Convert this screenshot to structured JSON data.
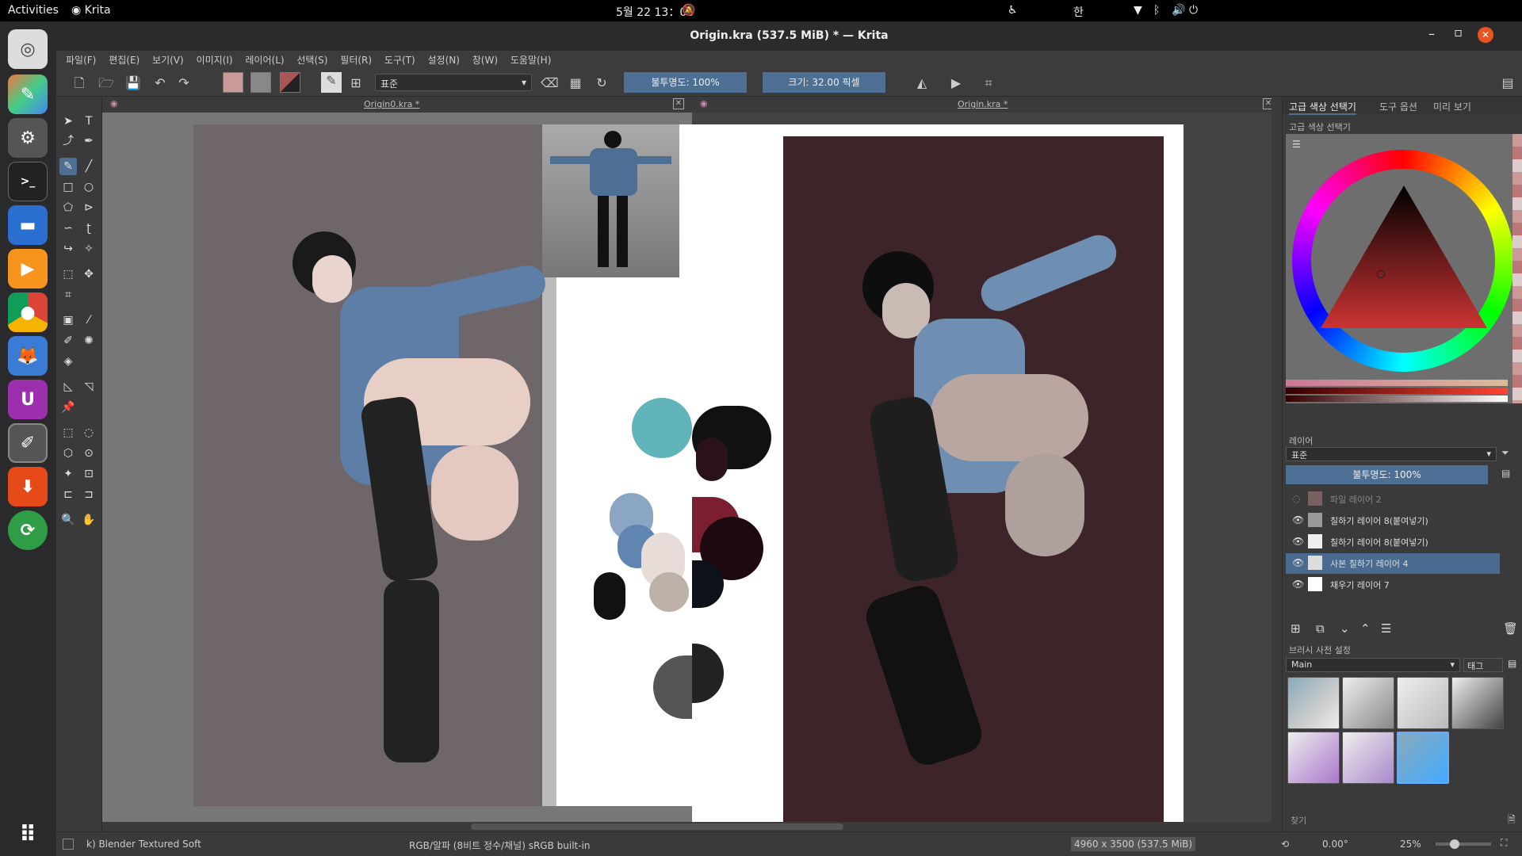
{
  "system": {
    "activities": "Activities",
    "app_name": "Krita",
    "clock": "5월 22  13：06",
    "lang": "한"
  },
  "window": {
    "title": "Origin.kra (537.5 MiB)  * — Krita"
  },
  "menu": [
    "파일(F)",
    "편집(E)",
    "보기(V)",
    "이미지(I)",
    "레이어(L)",
    "선택(S)",
    "필터(R)",
    "도구(T)",
    "설정(N)",
    "창(W)",
    "도움말(H)"
  ],
  "toolbar": {
    "blend_mode": "표준",
    "opacity": "불투명도: 100%",
    "size": "크기: 32.00 픽셀"
  },
  "docs": [
    {
      "tab": "Origin0.kra *"
    },
    {
      "tab": "Origin.kra *"
    }
  ],
  "panels": {
    "tabs": [
      "고급 색상 선택기",
      "도구 옵션",
      "미리 보기"
    ],
    "color_title": "고급 색상 선택기",
    "layers_title": "레이어",
    "layers_blend": "표준",
    "layers_opacity": "불투명도: 100%",
    "layers": [
      {
        "name": "파일 레이어 2",
        "visible": false,
        "selected": false
      },
      {
        "name": "칠하기 레이어 8(붙여넣기)",
        "visible": true,
        "selected": false
      },
      {
        "name": "칠하기 레이어 8(붙여넣기)",
        "visible": true,
        "selected": false
      },
      {
        "name": "사본 칠하기 레이어 4",
        "visible": true,
        "selected": true
      },
      {
        "name": "채우기 레이어 7",
        "visible": true,
        "selected": false
      }
    ],
    "brush_title": "브러시 사전 설정",
    "brush_group": "Main",
    "brush_tag": "태그",
    "search": "찾기"
  },
  "status": {
    "brush": "k) Blender Textured Soft",
    "color": "RGB/알파 (8비트 정수/채널)  sRGB built-in",
    "dims": "4960 x 3500 (537.5 MiB)",
    "rotation": "0.00°",
    "zoom": "25%"
  },
  "colors": {
    "accent": "#4d6f94",
    "selected_layer": "#4a6a8f"
  }
}
